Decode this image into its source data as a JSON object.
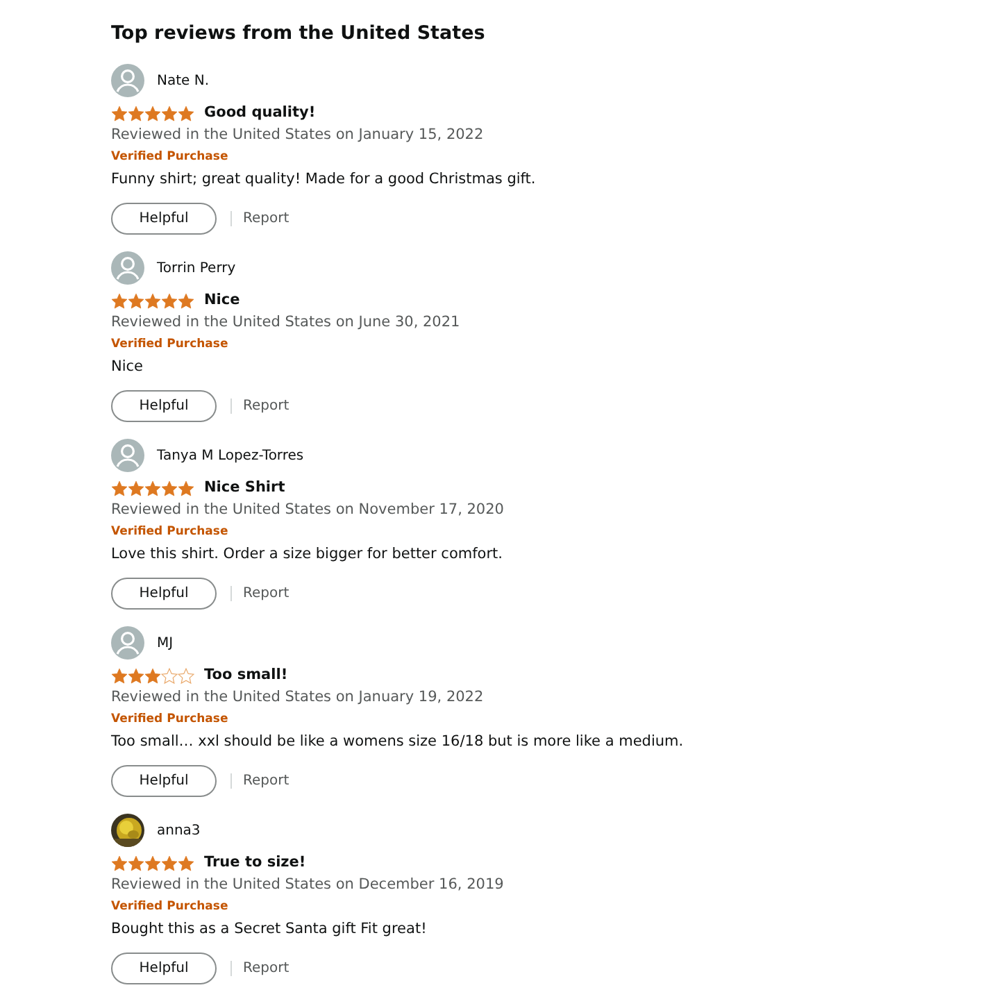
{
  "heading": "Top reviews from the United States",
  "reviews": [
    {
      "has_photo": false,
      "name": "Nate N.",
      "stars": 5,
      "title": "Good quality!",
      "date": "Reviewed in the United States on January 15, 2022",
      "badge": "Verified Purchase",
      "body": "Funny shirt; great quality! Made for a good Christmas gift.",
      "helpful": "Helpful",
      "report": "Report"
    },
    {
      "has_photo": false,
      "name": "Torrin Perry",
      "stars": 5,
      "title": "Nice",
      "date": "Reviewed in the United States on June 30, 2021",
      "badge": "Verified Purchase",
      "body": "Nice",
      "helpful": "Helpful",
      "report": "Report"
    },
    {
      "has_photo": false,
      "name": "Tanya M Lopez-Torres",
      "stars": 5,
      "title": "Nice Shirt",
      "date": "Reviewed in the United States on November 17, 2020",
      "badge": "Verified Purchase",
      "body": "Love this shirt. Order a size bigger for better comfort.",
      "helpful": "Helpful",
      "report": "Report"
    },
    {
      "has_photo": false,
      "name": "MJ",
      "stars": 3,
      "title": "Too small!",
      "date": "Reviewed in the United States on January 19, 2022",
      "badge": "Verified Purchase",
      "body": "Too small… xxl should be like a womens size 16/18 but is more like a medium.",
      "helpful": "Helpful",
      "report": "Report"
    },
    {
      "has_photo": true,
      "name": "anna3",
      "stars": 5,
      "title": "True to size!",
      "date": "Reviewed in the United States on December 16, 2019",
      "badge": "Verified Purchase",
      "body": "Bought this as a Secret Santa gift Fit great!",
      "helpful": "Helpful",
      "report": "Report"
    }
  ]
}
